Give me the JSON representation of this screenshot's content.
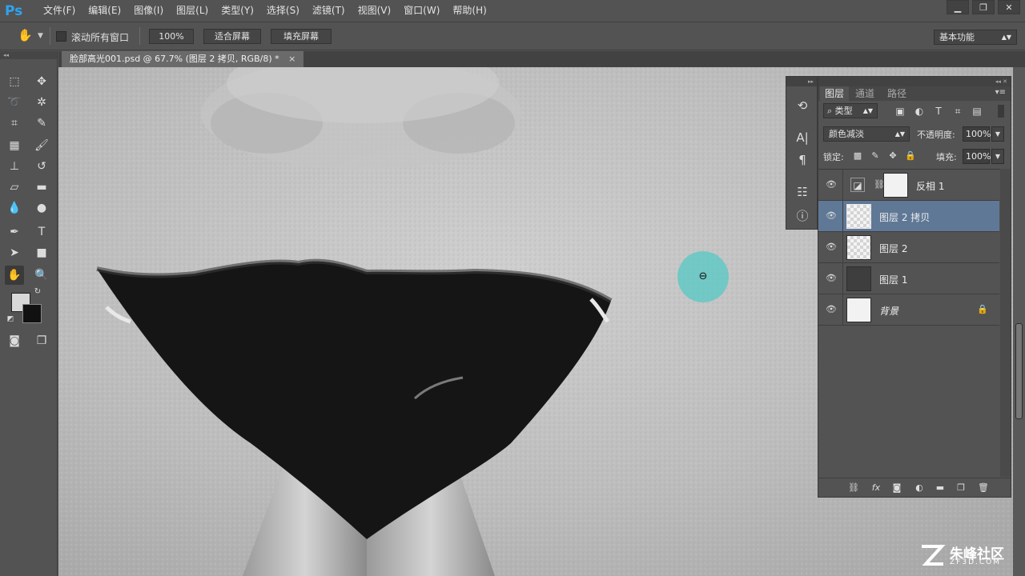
{
  "app": {
    "logo": "Ps"
  },
  "menu": [
    "文件(F)",
    "编辑(E)",
    "图像(I)",
    "图层(L)",
    "类型(Y)",
    "选择(S)",
    "滤镜(T)",
    "视图(V)",
    "窗口(W)",
    "帮助(H)"
  ],
  "window_controls": {
    "minimize": "▁",
    "restore": "❐",
    "close": "✕"
  },
  "options": {
    "scroll_all_label": "滚动所有窗口",
    "zoom_100": "100%",
    "fit_screen": "适合屏幕",
    "fill_screen": "填充屏幕",
    "workspace": "基本功能"
  },
  "document": {
    "tab_title": "脸部高光001.psd @ 67.7% (图层 2 拷贝, RGB/8) *",
    "close": "×"
  },
  "layers_panel": {
    "tabs": [
      "图层",
      "通道",
      "路径"
    ],
    "filter": "类型",
    "blend_mode": "颜色减淡",
    "opacity_label": "不透明度:",
    "opacity": "100%",
    "lock_label": "锁定:",
    "fill_label": "填充:",
    "fill": "100%",
    "layers": [
      {
        "name": "反相 1",
        "type": "adjustment"
      },
      {
        "name": "图层 2 拷贝",
        "type": "pixel",
        "selected": true
      },
      {
        "name": "图层 2",
        "type": "pixel"
      },
      {
        "name": "图层 1",
        "type": "pixel"
      },
      {
        "name": "背景",
        "type": "background",
        "locked": true
      }
    ]
  },
  "icons": {
    "hand": "hand-icon",
    "zoom_cursor": "zoom-out-icon"
  },
  "colors": {
    "selected_layer": "#5f7896",
    "cursor_highlight": "#56c8c4",
    "ps_blue": "#2fa3ef"
  },
  "watermark": {
    "title": "朱峰社区",
    "sub": "ZF3D.COM"
  }
}
